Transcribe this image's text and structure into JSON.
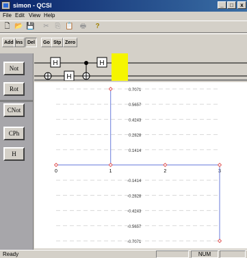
{
  "window": {
    "title": "simon - QCSI",
    "minimize_glyph": "_",
    "maximize_glyph": "□",
    "close_glyph": "x"
  },
  "menu": [
    "File",
    "Edit",
    "View",
    "Help"
  ],
  "toolbar": {
    "icons": [
      "new-icon",
      "open-icon",
      "save-icon",
      "cut-icon",
      "copy-icon",
      "paste-icon",
      "print-icon",
      "help-icon"
    ],
    "glyphs": [
      "🗋",
      "📂",
      "💾",
      "✂",
      "⎘",
      "📋",
      "🖶",
      "?"
    ]
  },
  "toolbar2": [
    "Add",
    "Ins",
    "Del",
    "Go",
    "Stp",
    "Zero"
  ],
  "gate_buttons": [
    "Not",
    "Rot",
    "CNot",
    "CPh",
    "H"
  ],
  "circuit": {
    "hadamard_label": "H",
    "top_gates": [
      "H",
      "H"
    ],
    "bottom_gates": [
      "H"
    ],
    "highlight_color": "#f5f500"
  },
  "chart_data": {
    "type": "line",
    "x": [
      0,
      1,
      1,
      2,
      3,
      3
    ],
    "y": [
      0,
      0,
      0.7071,
      0,
      0,
      -0.7071
    ],
    "series": [
      {
        "points": [
          [
            0,
            0
          ],
          [
            1,
            0
          ],
          [
            1,
            0.7071
          ],
          [
            1,
            0
          ],
          [
            2,
            0
          ],
          [
            3,
            0
          ],
          [
            3,
            -0.7071
          ]
        ]
      }
    ],
    "xticks": [
      "0",
      "1",
      "2",
      "3"
    ],
    "yticks": [
      "0.7071",
      "0.5657",
      "0.4243",
      "0.2828",
      "0.1414",
      "-0.1414",
      "-0.2828",
      "-0.4243",
      "-0.5657",
      "-0.7071"
    ],
    "ylim": [
      -0.7071,
      0.7071
    ],
    "xlim": [
      0,
      3
    ],
    "line_color": "#8090e0",
    "marker_color": "#e05050"
  },
  "status": {
    "text": "Ready",
    "num": "NUM"
  }
}
